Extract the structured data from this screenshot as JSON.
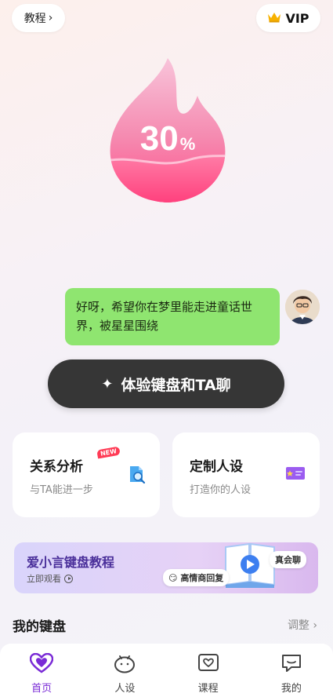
{
  "header": {
    "tutorial_label": "教程",
    "vip_label": "VIP"
  },
  "meter": {
    "value": "30",
    "unit": "%"
  },
  "chat": {
    "message": "好呀，希望你在梦里能走进童话世界，被星星围绕"
  },
  "cta": {
    "label": "体验键盘和TA聊"
  },
  "cards": [
    {
      "title": "关系分析",
      "subtitle": "与TA能进一步",
      "badge": "NEW"
    },
    {
      "title": "定制人设",
      "subtitle": "打造你的人设"
    }
  ],
  "banner": {
    "title": "爱小言键盘教程",
    "subtitle": "立即观看",
    "tag_high": "高情商回复",
    "tag_real": "真会聊"
  },
  "keyboard_section": {
    "title": "我的键盘",
    "adjust_label": "调整"
  },
  "tabs": [
    {
      "label": "首页",
      "active": true
    },
    {
      "label": "人设",
      "active": false
    },
    {
      "label": "课程",
      "active": false
    },
    {
      "label": "我的",
      "active": false
    }
  ],
  "colors": {
    "accent": "#7a2bd6",
    "bubble": "#8fe570",
    "cta": "#363636",
    "flame_top": "#f5a8c8",
    "flame_bottom": "#ff4f8a"
  }
}
